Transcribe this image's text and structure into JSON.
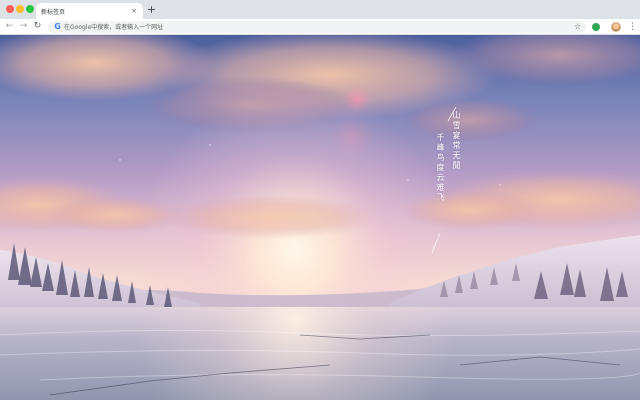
{
  "browser": {
    "tab": {
      "title": "新标签页",
      "close_glyph": "×"
    },
    "new_tab_glyph": "+",
    "nav": {
      "back_glyph": "←",
      "forward_glyph": "→",
      "reload_glyph": "↻"
    },
    "omnibox": {
      "placeholder": "在Google中搜索，或者输入一个网址",
      "value": "",
      "logo_glyph": "G"
    },
    "bookmark_glyph": "☆",
    "menu_glyph": "⋮"
  },
  "page": {
    "poem": {
      "lines": [
        "山雪宴常无閒",
        "千峰鸟度云难飞"
      ]
    }
  },
  "colors": {
    "tabstrip": "#dee1e6",
    "toolbar": "#ffffff",
    "omnibox": "#f1f3f4",
    "traffic_close": "#ff5f57",
    "traffic_min": "#febc2e",
    "traffic_max": "#28c840",
    "extension": "#34a853"
  }
}
